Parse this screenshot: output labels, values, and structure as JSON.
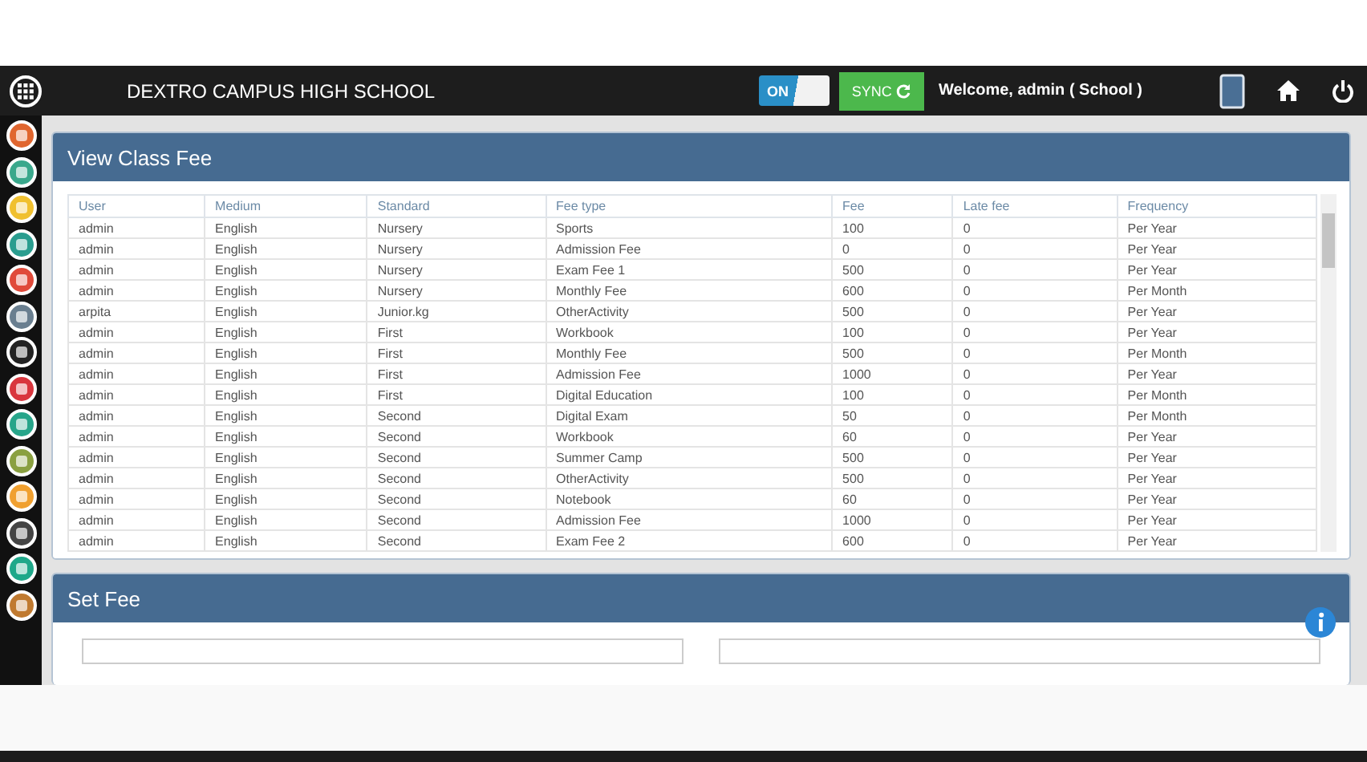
{
  "header": {
    "title": "DEXTRO CAMPUS HIGH SCHOOL",
    "toggle": {
      "label": "ON",
      "on": true
    },
    "sync_button": "SYNC",
    "welcome": "Welcome, admin ( School )"
  },
  "sidebar": {
    "items": [
      {
        "color": "#e0662f"
      },
      {
        "color": "#3aa88c"
      },
      {
        "color": "#f0c030"
      },
      {
        "color": "#2a9d8f"
      },
      {
        "color": "#e04a3a"
      },
      {
        "color": "#6a7f90"
      },
      {
        "color": "#222222"
      },
      {
        "color": "#d9363e"
      },
      {
        "color": "#27a58a"
      },
      {
        "color": "#8aa040"
      },
      {
        "color": "#f0a030"
      },
      {
        "color": "#444444"
      },
      {
        "color": "#1fa88a"
      },
      {
        "color": "#c07a30"
      }
    ]
  },
  "view_panel": {
    "title": "View Class Fee",
    "table": {
      "columns": [
        "User",
        "Medium",
        "Standard",
        "Fee type",
        "Fee",
        "Late fee",
        "Frequency"
      ],
      "rows": [
        [
          "admin",
          "English",
          "Nursery",
          "Sports",
          "100",
          "0",
          "Per Year"
        ],
        [
          "admin",
          "English",
          "Nursery",
          "Admission Fee",
          "0",
          "0",
          "Per Year"
        ],
        [
          "admin",
          "English",
          "Nursery",
          "Exam Fee 1",
          "500",
          "0",
          "Per Year"
        ],
        [
          "admin",
          "English",
          "Nursery",
          "Monthly Fee",
          "600",
          "0",
          "Per Month"
        ],
        [
          "arpita",
          "English",
          "Junior.kg",
          "OtherActivity",
          "500",
          "0",
          "Per Year"
        ],
        [
          "admin",
          "English",
          "First",
          "Workbook",
          "100",
          "0",
          "Per Year"
        ],
        [
          "admin",
          "English",
          "First",
          "Monthly Fee",
          "500",
          "0",
          "Per Month"
        ],
        [
          "admin",
          "English",
          "First",
          "Admission Fee",
          "1000",
          "0",
          "Per Year"
        ],
        [
          "admin",
          "English",
          "First",
          "Digital Education",
          "100",
          "0",
          "Per Month"
        ],
        [
          "admin",
          "English",
          "Second",
          "Digital Exam",
          "50",
          "0",
          "Per Month"
        ],
        [
          "admin",
          "English",
          "Second",
          "Workbook",
          "60",
          "0",
          "Per Year"
        ],
        [
          "admin",
          "English",
          "Second",
          "Summer Camp",
          "500",
          "0",
          "Per Year"
        ],
        [
          "admin",
          "English",
          "Second",
          "OtherActivity",
          "500",
          "0",
          "Per Year"
        ],
        [
          "admin",
          "English",
          "Second",
          "Notebook",
          "60",
          "0",
          "Per Year"
        ],
        [
          "admin",
          "English",
          "Second",
          "Admission Fee",
          "1000",
          "0",
          "Per Year"
        ],
        [
          "admin",
          "English",
          "Second",
          "Exam Fee 2",
          "600",
          "0",
          "Per Year"
        ]
      ]
    }
  },
  "set_panel": {
    "title": "Set Fee"
  }
}
